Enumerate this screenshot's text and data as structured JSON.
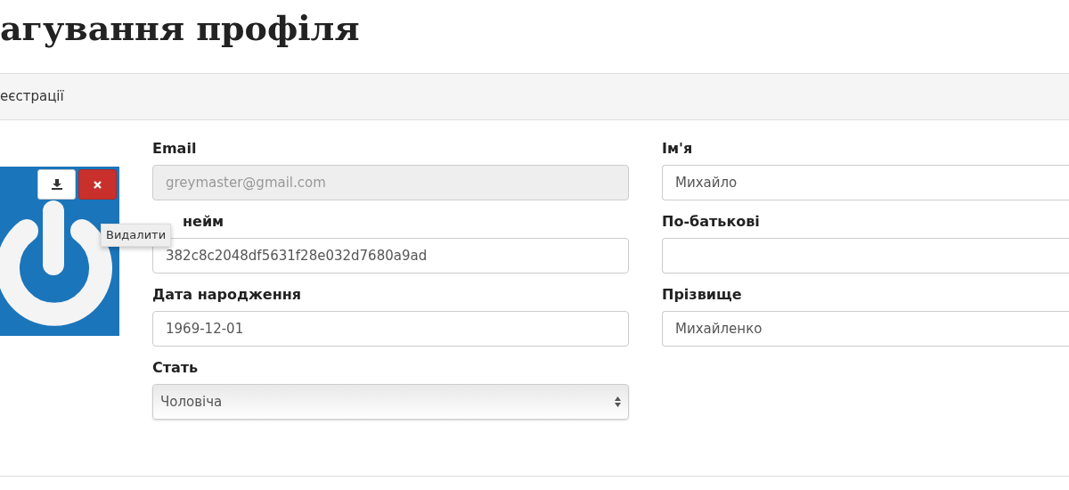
{
  "page_title": "агування профіля",
  "panel": {
    "heading": "еєстрації"
  },
  "avatar": {
    "kind": "picture",
    "buttons": [
      {
        "kind": "download"
      },
      {
        "kind": "delete"
      }
    ],
    "tooltip": "Видалити"
  },
  "left_fields": [
    {
      "label": "Email",
      "kind": "input",
      "value": "greymaster@gmail.com",
      "disabled": true
    },
    {
      "label": "нейм",
      "kind": "input",
      "value": "382c8c2048df5631f28e032d7680a9ad",
      "disabled": false
    },
    {
      "label": "Дата народження",
      "kind": "input",
      "value": "1969-12-01",
      "disabled": false
    },
    {
      "label": "Стать",
      "kind": "select",
      "value": "Чоловіча",
      "disabled": false
    }
  ],
  "right_fields": [
    {
      "label": "Ім'я",
      "kind": "input",
      "value": "Михайло",
      "disabled": false
    },
    {
      "label": "По-батькові",
      "kind": "input",
      "disabled": false
    },
    {
      "label": "Прізвище",
      "kind": "input",
      "value": "Михайленко",
      "disabled": false
    }
  ]
}
